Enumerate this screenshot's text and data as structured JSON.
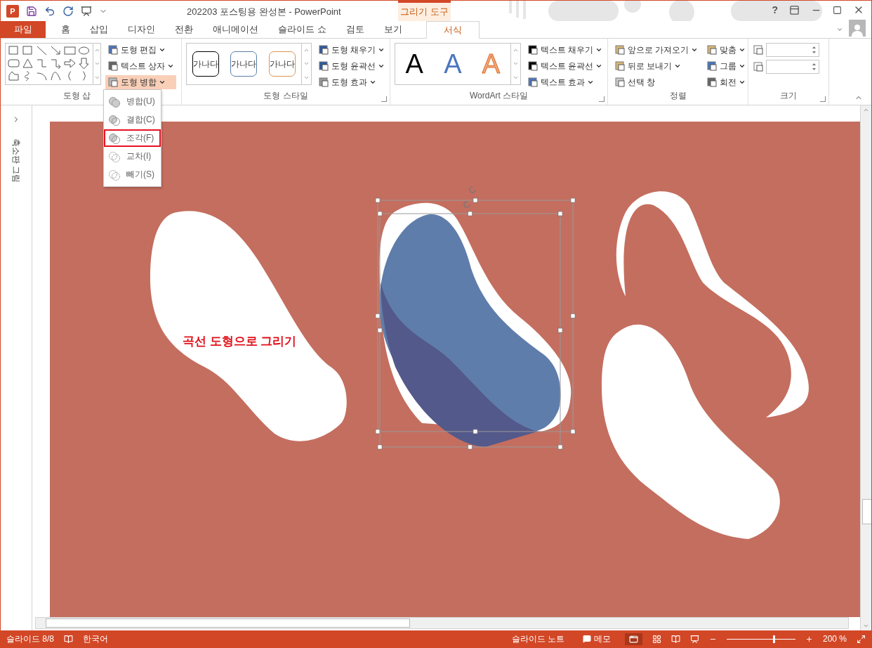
{
  "title_bar": {
    "app_icon": "P",
    "title": "202203 포스팅용 완성본 - PowerPoint",
    "help": "?"
  },
  "context_group": "그리기 도구",
  "tabs": [
    {
      "label": "파일",
      "kind": "file",
      "selected": false
    },
    {
      "label": "홈",
      "kind": "tab",
      "selected": false
    },
    {
      "label": "삽입",
      "kind": "tab",
      "selected": false
    },
    {
      "label": "디자인",
      "kind": "tab",
      "selected": false
    },
    {
      "label": "전환",
      "kind": "tab",
      "selected": false
    },
    {
      "label": "애니메이션",
      "kind": "tab",
      "selected": false
    },
    {
      "label": "슬라이드 쇼",
      "kind": "tab",
      "selected": false
    },
    {
      "label": "검토",
      "kind": "tab",
      "selected": false
    },
    {
      "label": "보기",
      "kind": "tab",
      "selected": false
    },
    {
      "label": "서식",
      "kind": "context",
      "selected": true
    }
  ],
  "ribbon": {
    "insert_shapes": {
      "label": "도형 삽",
      "commands": [
        {
          "label": "도형 편집",
          "dropdown": true,
          "selected": false
        },
        {
          "label": "텍스트 상자",
          "dropdown": true,
          "selected": false
        },
        {
          "label": "도형 병합",
          "dropdown": true,
          "selected": true
        }
      ]
    },
    "merge_menu": [
      {
        "label": "병합(U)",
        "selected": false
      },
      {
        "label": "결합(C)",
        "selected": false
      },
      {
        "label": "조각(F)",
        "selected": true
      },
      {
        "label": "교차(I)",
        "selected": false
      },
      {
        "label": "빼기(S)",
        "selected": false
      }
    ],
    "shape_styles": {
      "label": "도형 스타일",
      "samples": [
        {
          "text": "가나다",
          "color": "#000000"
        },
        {
          "text": "가나다",
          "color": "#5b7fa8"
        },
        {
          "text": "가나다",
          "color": "#e0954f"
        }
      ],
      "commands": [
        {
          "label": "도형 채우기",
          "dropdown": true
        },
        {
          "label": "도형 윤곽선",
          "dropdown": true
        },
        {
          "label": "도형 효과",
          "dropdown": true
        }
      ]
    },
    "wordart_styles": {
      "label": "WordArt 스타일",
      "samples": [
        {
          "text": "A",
          "color": "#000000"
        },
        {
          "text": "A",
          "color": "#4a76be"
        },
        {
          "text": "A",
          "color": "#f4a77c"
        }
      ],
      "commands": [
        {
          "label": "텍스트 채우기",
          "dropdown": true
        },
        {
          "label": "텍스트 윤곽선",
          "dropdown": true
        },
        {
          "label": "텍스트 효과",
          "dropdown": true
        }
      ]
    },
    "arrange": {
      "label": "정렬",
      "commands": [
        {
          "label": "앞으로 가져오기",
          "dropdown": true
        },
        {
          "label": "뒤로 보내기",
          "dropdown": true
        },
        {
          "label": "선택 창",
          "dropdown": false
        },
        {
          "label": "맞춤",
          "dropdown": true
        },
        {
          "label": "그룹",
          "dropdown": true
        },
        {
          "label": "회전",
          "dropdown": true
        }
      ]
    },
    "size": {
      "label": "크기"
    }
  },
  "thumbnail_pane": {
    "label": "축소판 그림"
  },
  "slide": {
    "text": "곡선 도형으로 그리기"
  },
  "status_bar": {
    "slide": "슬라이드 8/8",
    "language": "한국어",
    "notes": "슬라이드 노트",
    "comments": "메모",
    "zoom_slider": {
      "level": 0.68
    },
    "zoom": "200 %"
  }
}
